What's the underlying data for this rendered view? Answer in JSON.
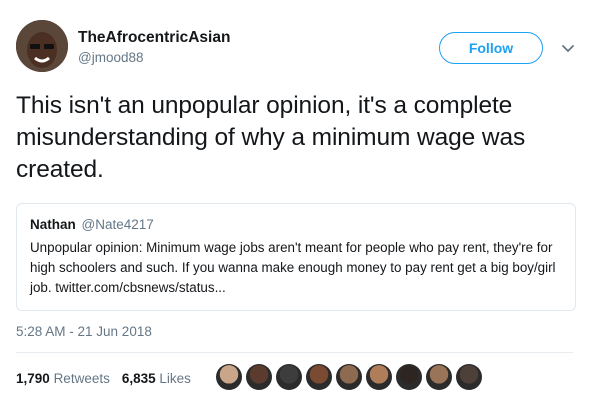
{
  "author": {
    "display_name": "TheAfrocentricAsian",
    "handle": "@jmood88"
  },
  "follow_button": {
    "label": "Follow"
  },
  "tweet": {
    "text": "This isn't an unpopular opinion, it's a complete misunderstanding of why a minimum wage was created.",
    "timestamp": "5:28 AM - 21 Jun 2018"
  },
  "quoted_tweet": {
    "name": "Nathan",
    "handle": "@Nate4217",
    "text": "Unpopular opinion: Minimum wage jobs aren't meant for people who pay rent, they're for high schoolers and such. If you wanna make enough money to pay rent get a big boy/girl job. twitter.com/cbsnews/status..."
  },
  "stats": {
    "retweets_count": "1,790",
    "retweets_label": "Retweets",
    "likes_count": "6,835",
    "likes_label": "Likes"
  },
  "likers": [
    {
      "color": "#c9a58a"
    },
    {
      "color": "#5a3b2e"
    },
    {
      "color": "#3d3d3d"
    },
    {
      "color": "#7a4a32"
    },
    {
      "color": "#8e6a50"
    },
    {
      "color": "#b07d5a"
    },
    {
      "color": "#2f2520"
    },
    {
      "color": "#9a7458"
    },
    {
      "color": "#4d4038"
    }
  ],
  "colors": {
    "accent": "#1da1f2",
    "secondary_text": "#657786",
    "primary_text": "#14171a"
  }
}
